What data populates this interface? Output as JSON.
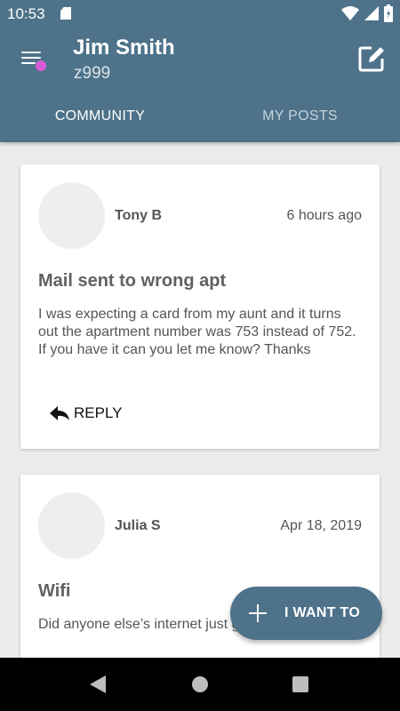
{
  "status_bar": {
    "time": "10:53"
  },
  "header": {
    "user_name": "Jim Smith",
    "user_id": "z999",
    "colors": {
      "bar": "#4d7289",
      "notification_dot": "#d85bd6"
    }
  },
  "tabs": [
    {
      "label": "COMMUNITY",
      "active": true
    },
    {
      "label": "MY POSTS",
      "active": false
    }
  ],
  "posts": [
    {
      "author": "Tony B",
      "time": "6 hours ago",
      "title": "Mail sent to wrong apt",
      "body": "I was expecting a card from my aunt and it turns out the apartment number was 753 instead of 752. If you have it can you let me know? Thanks",
      "reply_label": "REPLY"
    },
    {
      "author": "Julia S",
      "time": "Apr 18, 2019",
      "title": "Wifi",
      "body": "Did anyone else’s internet just go out?"
    }
  ],
  "fab": {
    "label": "I WANT TO",
    "icon": "plus-icon"
  },
  "icons": {
    "menu": "hamburger-menu-icon",
    "compose": "compose-icon",
    "reply": "reply-arrow-icon"
  }
}
